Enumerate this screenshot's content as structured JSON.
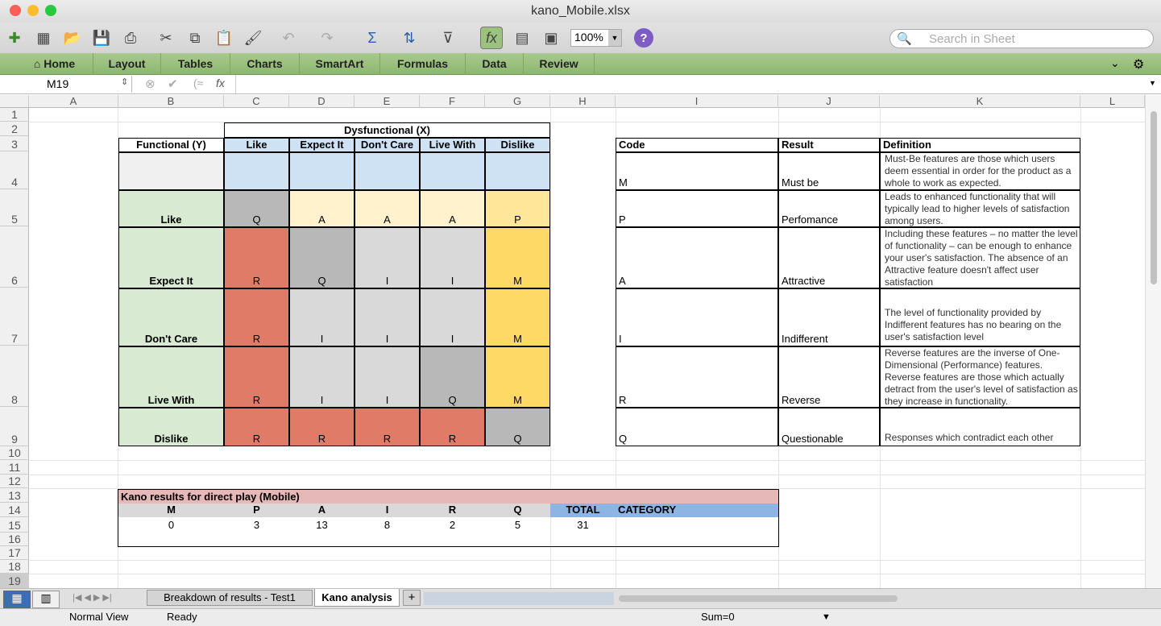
{
  "window": {
    "title": "kano_Mobile.xlsx"
  },
  "toolbar": {
    "zoom": "100%",
    "search_placeholder": "Search in Sheet"
  },
  "ribbon": {
    "tabs": [
      "Home",
      "Layout",
      "Tables",
      "Charts",
      "SmartArt",
      "Formulas",
      "Data",
      "Review"
    ]
  },
  "formula_bar": {
    "name_box": "M19",
    "fx": "fx",
    "formula": ""
  },
  "columns": [
    "A",
    "B",
    "C",
    "D",
    "E",
    "F",
    "G",
    "H",
    "I",
    "J",
    "K",
    "L"
  ],
  "rows": [
    "1",
    "2",
    "3",
    "4",
    "5",
    "6",
    "7",
    "8",
    "9",
    "10",
    "11",
    "12",
    "13",
    "14",
    "15",
    "16",
    "17",
    "18",
    "19"
  ],
  "matrix": {
    "dys_header": "Dysfunctional (X)",
    "func_header": "Functional (Y)",
    "col_headers": [
      "Like",
      "Expect It",
      "Don't Care",
      "Live With",
      "Dislike"
    ],
    "row_headers": [
      "Like",
      "Expect It",
      "Don't Care",
      "Live With",
      "Dislike"
    ],
    "cells": [
      [
        "Q",
        "A",
        "A",
        "A",
        "P"
      ],
      [
        "R",
        "Q",
        "I",
        "I",
        "M"
      ],
      [
        "R",
        "I",
        "I",
        "I",
        "M"
      ],
      [
        "R",
        "I",
        "I",
        "Q",
        "M"
      ],
      [
        "R",
        "R",
        "R",
        "R",
        "Q"
      ]
    ]
  },
  "legend": {
    "headers": [
      "Code",
      "Result",
      "Definition"
    ],
    "rows": [
      {
        "code": "M",
        "result": "Must be",
        "definition": "Must-Be features are those which users deem essential in order for the product as a whole to work as expected."
      },
      {
        "code": "P",
        "result": "Perfomance",
        "definition": "Leads to enhanced functionality that will typically lead to higher levels of satisfaction among users."
      },
      {
        "code": "A",
        "result": "Attractive",
        "definition": "Including these features – no matter the level of functionality – can be enough to enhance your user's satisfaction. The absence of an Attractive feature doesn't affect user satisfaction"
      },
      {
        "code": "I",
        "result": "Indifferent",
        "definition": "The level of functionality provided by Indifferent features has no bearing on the user's satisfaction level"
      },
      {
        "code": "R",
        "result": "Reverse",
        "definition": "Reverse features are the inverse of One-Dimensional (Performance) features. Reverse features are those which actually detract from the user's level of satisfaction as they increase in functionality."
      },
      {
        "code": "Q",
        "result": "Questionable",
        "definition": "Responses which contradict each other"
      }
    ]
  },
  "results": {
    "title": "Kano results for direct play (Mobile)",
    "headers": [
      "M",
      "P",
      "A",
      "I",
      "R",
      "Q",
      "TOTAL",
      "CATEGORY"
    ],
    "values": [
      "0",
      "3",
      "13",
      "8",
      "2",
      "5",
      "31",
      ""
    ]
  },
  "sheets": {
    "tabs": [
      "Breakdown of results - Test1",
      "Kano analysis"
    ],
    "active": "Kano analysis",
    "add": "+"
  },
  "status": {
    "view": "Normal View",
    "state": "Ready",
    "sum": "Sum=0"
  },
  "colors": {
    "Q": "#b8b8b8",
    "A": "#fff2cc",
    "P": "#ffe699",
    "R": "#e07b67",
    "I": "#d9d9d9",
    "M": "#ffd966",
    "header_blue": "#cfe2f3",
    "header_green": "#d9ead3",
    "results_pink": "#e6b8b7",
    "results_blue": "#8eb4e3",
    "ribbon": "#9cc37d"
  }
}
